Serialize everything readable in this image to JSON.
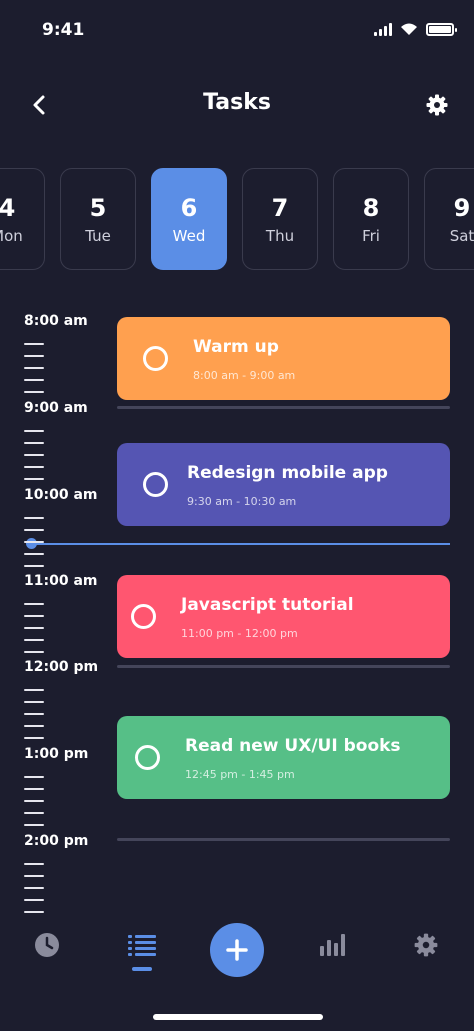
{
  "status_bar": {
    "time": "9:41",
    "battery_level": 1.0
  },
  "header": {
    "title": "Tasks",
    "back_icon": "chevron-left-icon",
    "settings_icon": "gear-icon"
  },
  "dates": [
    {
      "num": "4",
      "day": "Mon",
      "active": false
    },
    {
      "num": "5",
      "day": "Tue",
      "active": false
    },
    {
      "num": "6",
      "day": "Wed",
      "active": true
    },
    {
      "num": "7",
      "day": "Thu",
      "active": false
    },
    {
      "num": "8",
      "day": "Fri",
      "active": false
    },
    {
      "num": "9",
      "day": "Sat",
      "active": false
    }
  ],
  "timeline": {
    "hours": [
      "8:00 am",
      "9:00 am",
      "10:00 am",
      "11:00 am",
      "12:00 pm",
      "1:00 pm",
      "2:00 pm"
    ]
  },
  "tasks": [
    {
      "title": "Warm up",
      "time": "8:00 am - 9:00 am",
      "color": "#ffa04f"
    },
    {
      "title": "Redesign mobile app",
      "time": "9:30 am - 10:30 am",
      "color": "#5555b3"
    },
    {
      "title": "Javascript tutorial",
      "time": "11:00 pm - 12:00 pm",
      "color": "#ff5670"
    },
    {
      "title": "Read new UX/UI books",
      "time": "12:45 pm - 1:45 pm",
      "color": "#56bf87"
    }
  ],
  "bottom_nav": {
    "items": [
      "clock-icon",
      "list-icon",
      "plus-icon",
      "bar-chart-icon",
      "gear-icon"
    ],
    "active": "list-icon"
  },
  "colors": {
    "background": "#1c1d2e",
    "accent": "#5b8ee6",
    "divider": "#44455a"
  }
}
